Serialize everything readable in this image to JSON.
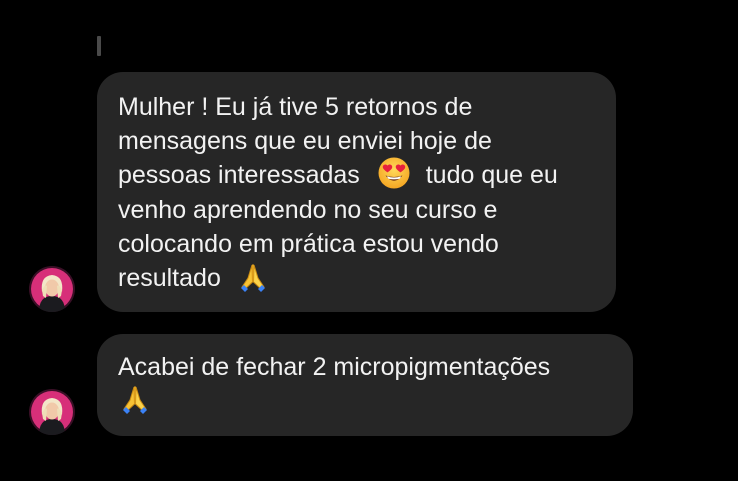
{
  "colors": {
    "background": "#000000",
    "bubble": "#262626",
    "text": "#f2f2f2",
    "avatar_ring": "#e0357a"
  },
  "messages": [
    {
      "lines": [
        "Mulher ! Eu já tive 5 retornos de",
        "mensagens que eu enviei hoje de",
        "pessoas interessadas",
        "tudo que eu",
        "venho aprendendo no seu curso e",
        "colocando em prática estou vendo",
        "resultado"
      ],
      "emojis": [
        "heart-eyes-emoji",
        "folded-hands-emoji"
      ]
    },
    {
      "lines": [
        "Acabei de fechar 2 micropigmentações"
      ],
      "emojis": [
        "folded-hands-emoji"
      ]
    }
  ]
}
